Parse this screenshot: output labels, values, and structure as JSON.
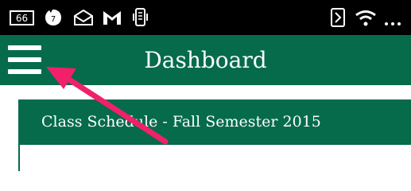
{
  "status_bar": {
    "notification_badge": "66",
    "notification_count": "7",
    "icons": [
      "notification-badge-icon",
      "clock-icon",
      "mail-icon",
      "gmail-icon",
      "phone-vibrate-icon",
      "nfc-icon",
      "wifi-icon",
      "more-icon"
    ]
  },
  "app_bar": {
    "menu_icon": "hamburger-menu-icon",
    "title": "Dashboard",
    "color": "#056b4b"
  },
  "card": {
    "title": "Class Schedule - Fall Semester 2015"
  },
  "annotation": {
    "arrow_color": "#f0206a"
  }
}
